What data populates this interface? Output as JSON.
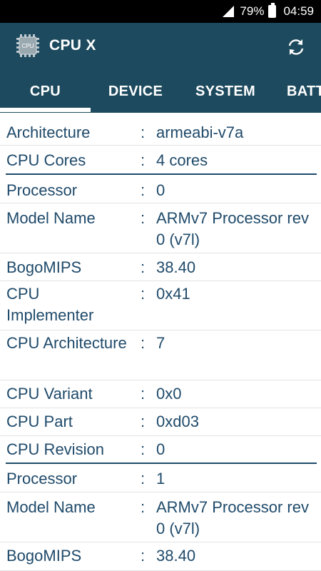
{
  "status_bar": {
    "battery_percent": "79%",
    "time": "04:59",
    "icons": [
      "signal-icon",
      "battery-icon"
    ]
  },
  "app": {
    "title": "CPU X",
    "logo_text": "CPU",
    "colors": {
      "app_bar": "#1d4a5e",
      "text": "#1f4a6a",
      "divider": "#1f4a6a"
    }
  },
  "tabs": [
    {
      "label": "CPU",
      "selected": true
    },
    {
      "label": "DEVICE",
      "selected": false
    },
    {
      "label": "SYSTEM",
      "selected": false
    },
    {
      "label": "BATTERY",
      "selected": false
    }
  ],
  "cpu_info": [
    {
      "label": "Architecture",
      "colon": ":",
      "value": "armeabi-v7a"
    },
    {
      "label": "CPU Cores",
      "colon": ":",
      "value": "4 cores"
    },
    {
      "label": "Processor",
      "colon": ":",
      "value": "0"
    },
    {
      "label": "Model Name",
      "colon": ":",
      "value": "ARMv7 Processor rev 0 (v7l)"
    },
    {
      "label": "BogoMIPS",
      "colon": ":",
      "value": "38.40"
    },
    {
      "label": "CPU Implementer",
      "colon": ":",
      "value": "0x41"
    },
    {
      "label": "CPU Architecture",
      "colon": ":",
      "value": "7"
    },
    {
      "label": "CPU Variant",
      "colon": ":",
      "value": "0x0"
    },
    {
      "label": "CPU Part",
      "colon": ":",
      "value": "0xd03"
    },
    {
      "label": "CPU Revision",
      "colon": ":",
      "value": "0"
    },
    {
      "label": "Processor",
      "colon": ":",
      "value": "1"
    },
    {
      "label": "Model Name",
      "colon": ":",
      "value": "ARMv7 Processor rev 0 (v7l)"
    },
    {
      "label": "BogoMIPS",
      "colon": ":",
      "value": "38.40"
    }
  ]
}
